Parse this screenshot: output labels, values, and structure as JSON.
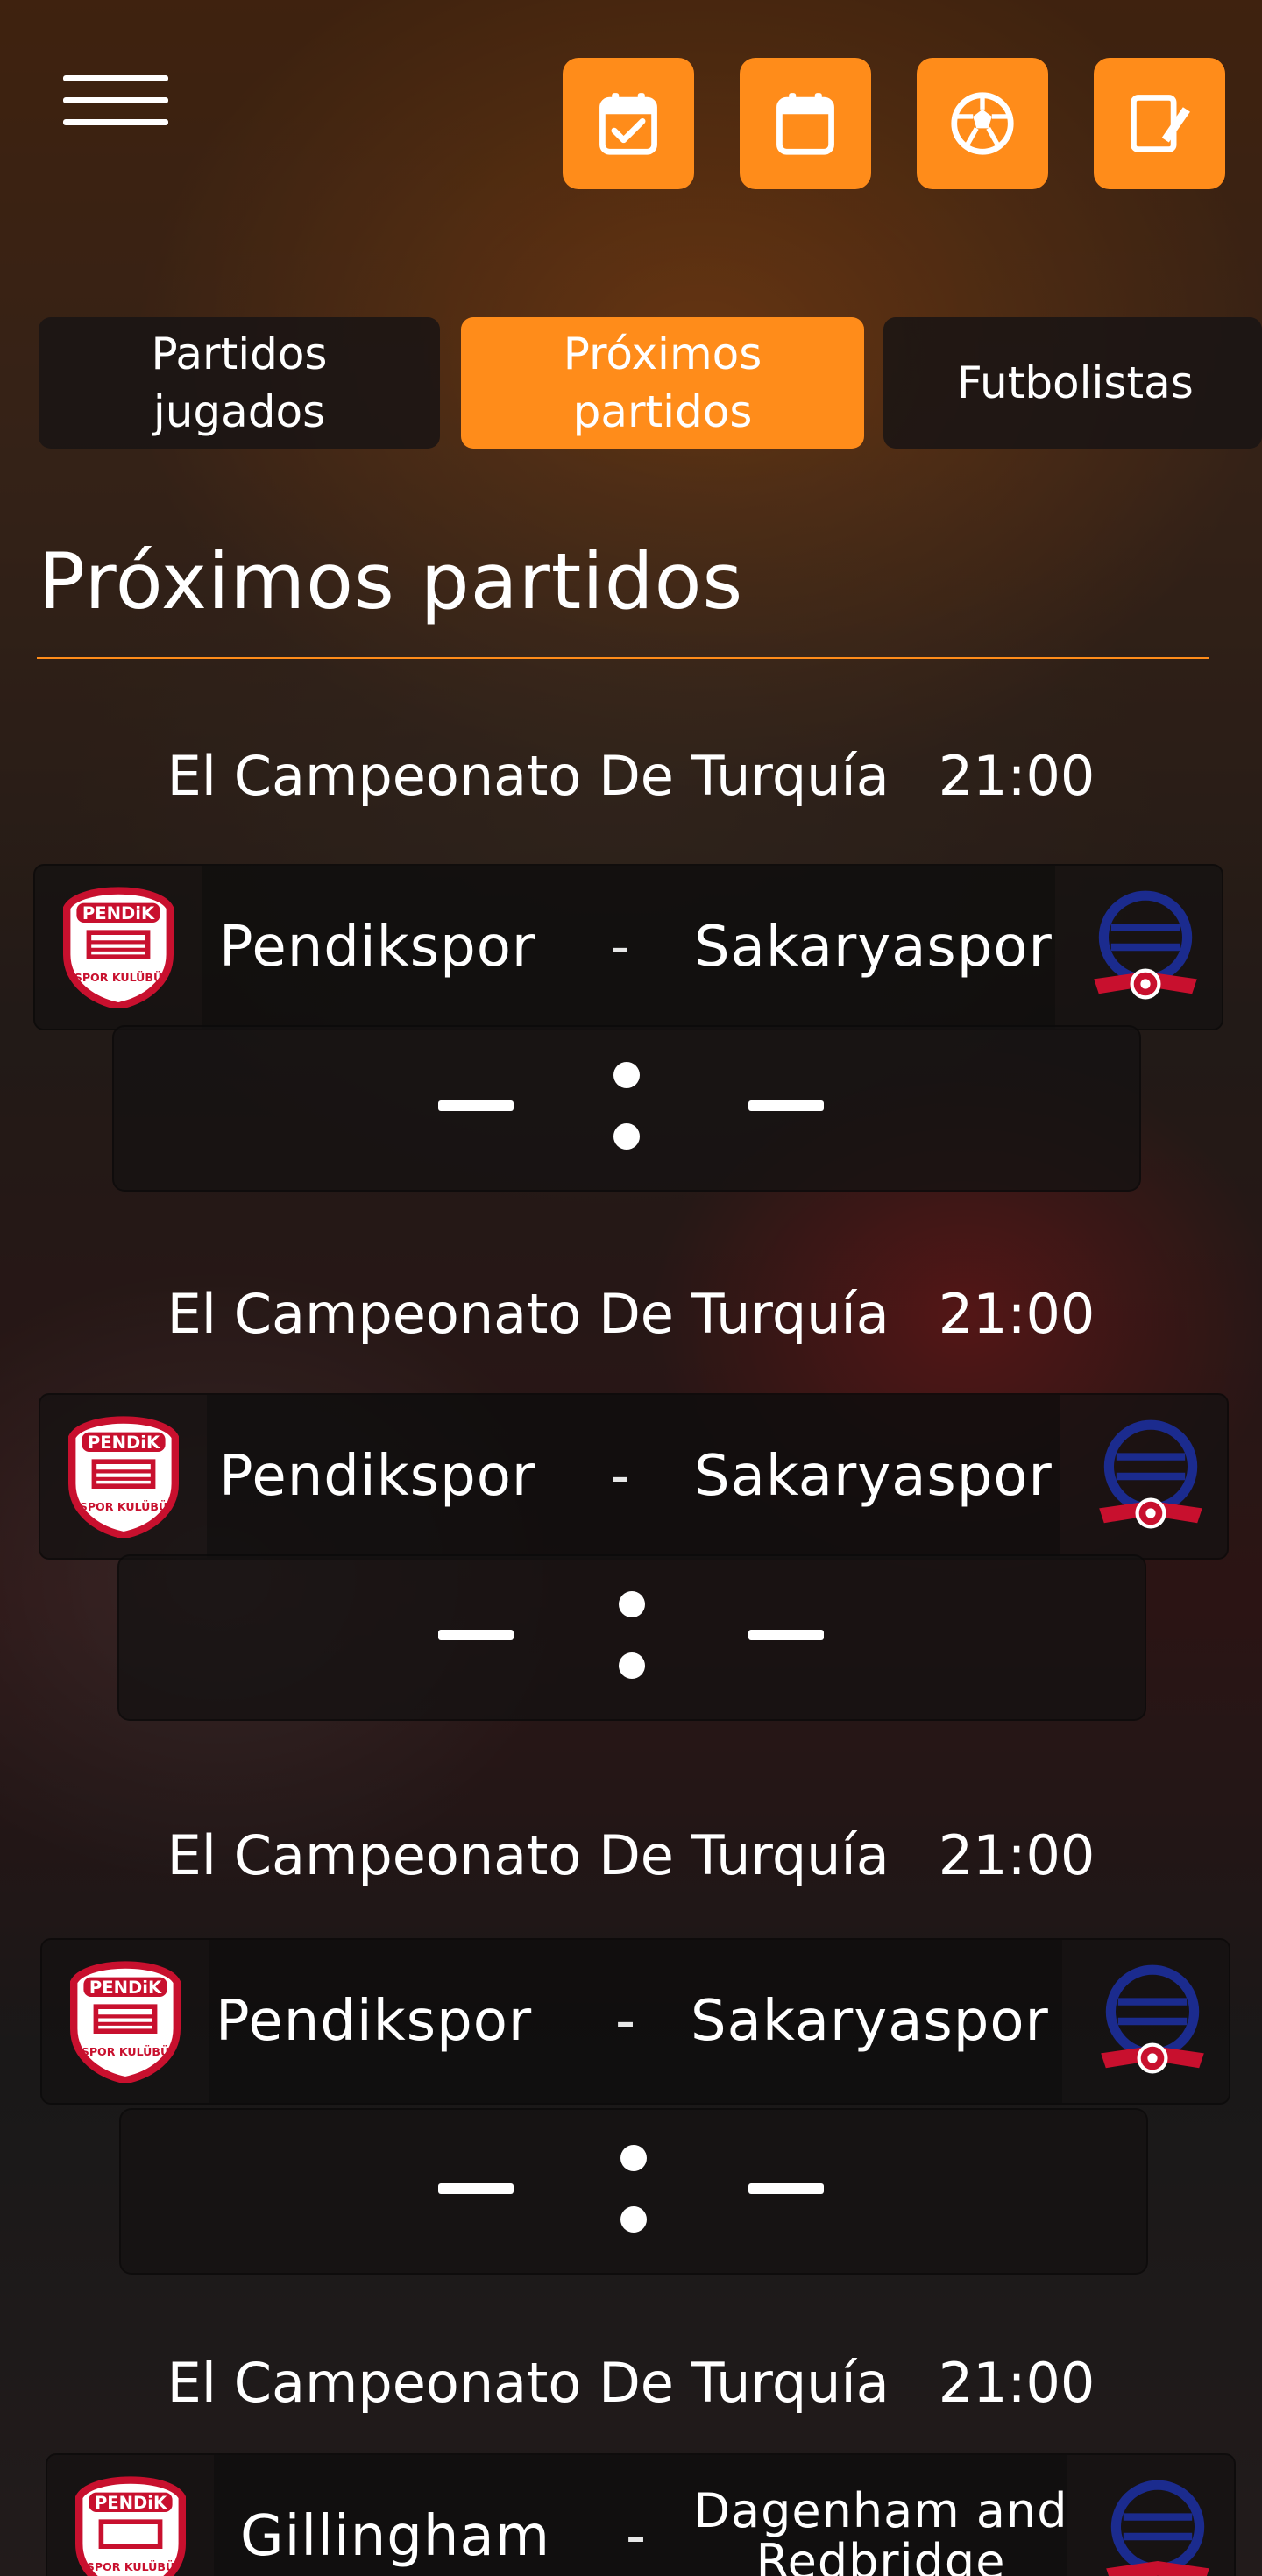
{
  "header": {
    "icons": [
      {
        "name": "calendar-check-icon",
        "color": "#ff8c1a"
      },
      {
        "name": "calendar-icon",
        "color": "#ff8c1a"
      },
      {
        "name": "soccer-ball-icon",
        "color": "#ff8c1a"
      },
      {
        "name": "edit-note-icon",
        "color": "#ff8c1a"
      }
    ]
  },
  "tabs": [
    {
      "label": "Partidos jugados",
      "active": false
    },
    {
      "label": "Próximos partidos",
      "active": true
    },
    {
      "label": "Futbolistas",
      "active": false
    }
  ],
  "section": {
    "title": "Próximos partidos"
  },
  "matches": [
    {
      "league": "El Campeonato De Turquía",
      "time": "21:00",
      "home": "Pendikspor",
      "separator": "-",
      "away": "Sakaryaspor",
      "score_home": "—",
      "score_away": "—"
    },
    {
      "league": "El Campeonato De Turquía",
      "time": "21:00",
      "home": "Pendikspor",
      "separator": "-",
      "away": "Sakaryaspor",
      "score_home": "—",
      "score_away": "—"
    },
    {
      "league": "El Campeonato De Turquía",
      "time": "21:00",
      "home": "Pendikspor",
      "separator": "-",
      "away": "Sakaryaspor",
      "score_home": "—",
      "score_away": "—"
    },
    {
      "league": "El Campeonato De Turquía",
      "time": "21:00",
      "home": "Gillingham",
      "separator": "-",
      "away": "Dagenham and Redbridge",
      "score_home": "—",
      "score_away": "—"
    }
  ],
  "colors": {
    "accent": "#ff8c1a",
    "card_bg": "#141212",
    "text": "#ffffff"
  }
}
